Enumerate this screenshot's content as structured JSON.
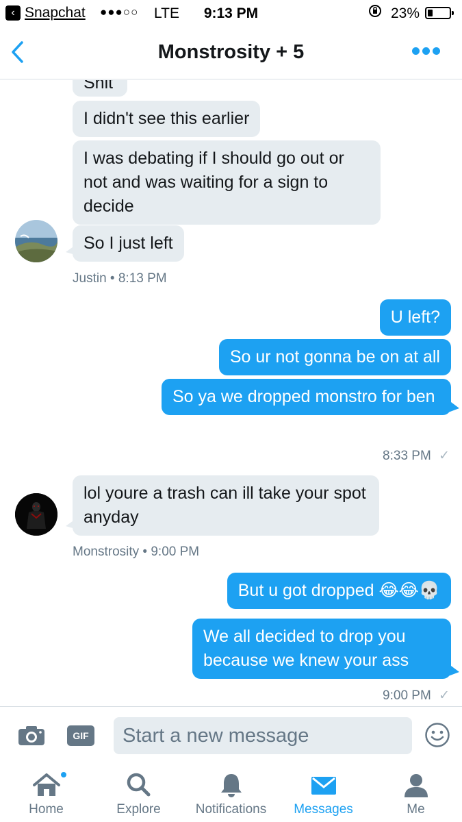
{
  "status_bar": {
    "back_app": "Snapchat",
    "signal": "●●●○○",
    "carrier": "LTE",
    "time": "9:13 PM",
    "battery": "23%",
    "battery_level": 0.23
  },
  "header": {
    "title": "Monstrosity + 5"
  },
  "messages": {
    "m0": "Shit",
    "m1": "I didn't see this earlier",
    "m2": "I was debating if I should go out or not and was waiting for a sign to decide",
    "m3": "So I just left",
    "meta1": "Justin • 8:13 PM",
    "m4": "U left?",
    "m5": "So ur not gonna be on at all",
    "m6": "So ya we dropped monstro for ben",
    "meta2": "8:33 PM",
    "m7": "lol youre a trash can ill take your spot anyday",
    "meta3": "Monstrosity • 9:00 PM",
    "m8": "But u got dropped 😂😂💀",
    "m9": "We all decided to drop you because we knew your ass",
    "meta4": "9:00 PM",
    "check": "✓"
  },
  "composer": {
    "gif_label": "GIF",
    "placeholder": "Start a new message"
  },
  "tabs": {
    "home": "Home",
    "explore": "Explore",
    "notifications": "Notifications",
    "messages": "Messages",
    "me": "Me"
  },
  "colors": {
    "accent": "#1da1f2",
    "incoming_bubble": "#e6ecf0",
    "muted_text": "#657786"
  }
}
